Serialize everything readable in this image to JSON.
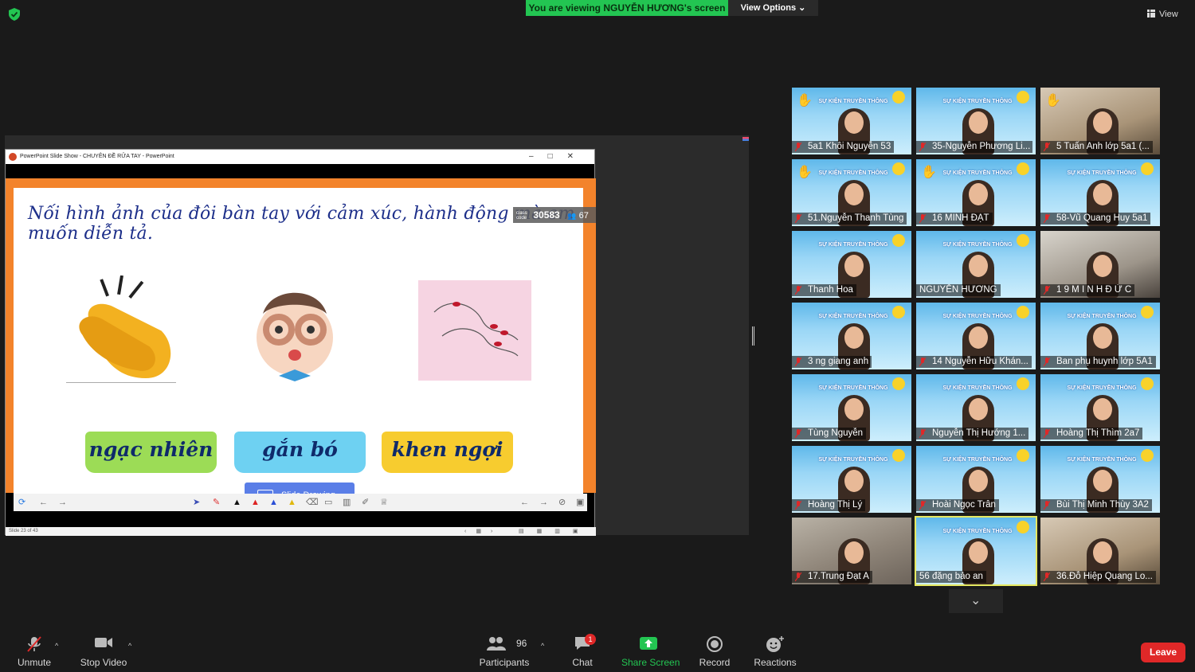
{
  "top": {
    "viewing_banner": "You are viewing NGUYỄN HƯƠNG's screen",
    "view_options": "View Options",
    "view_label": "View"
  },
  "ppt": {
    "window_title": "PowerPoint Slide Show  -  CHUYÊN ĐỀ RỬA TAY  -  PowerPoint",
    "slide_title": "Nối hình ảnh của đôi bàn tay với cảm xúc, hành động mà em muốn diễn tả.",
    "class_code_label": "class code",
    "class_code": "30583",
    "participant_count": "67",
    "words": [
      "ngạc nhiên",
      "gắn bó",
      "khen ngợi"
    ],
    "slide_drawing_button": "Slide Drawing",
    "status": "Slide 23 of 43"
  },
  "gallery": {
    "tiles": [
      {
        "name": "5a1 Khôi Nguyễn 53"
      },
      {
        "name": "35-Nguyễn Phương Li..."
      },
      {
        "name": "5 Tuấn Anh lớp 5a1 (..."
      },
      {
        "name": "51.Nguyễn Thanh Tùng"
      },
      {
        "name": "16 MINH ĐẠT"
      },
      {
        "name": "58-Vũ Quang Huy 5a1"
      },
      {
        "name": "Thanh Hoa"
      },
      {
        "name": "NGUYỄN HƯƠNG"
      },
      {
        "name": "1 9 M I N H Đ Ứ C"
      },
      {
        "name": "3 ng giang anh"
      },
      {
        "name": "14 Nguyễn Hữu Khán..."
      },
      {
        "name": "Ban phụ huynh lớp 5A1"
      },
      {
        "name": "Tùng Nguyễn"
      },
      {
        "name": "Nguyễn Thị Hướng 1..."
      },
      {
        "name": "Hoàng Thị Thìm 2a7"
      },
      {
        "name": "Hoàng Thị Lý"
      },
      {
        "name": "Hoài Ngọc Trân"
      },
      {
        "name": "Bùi Thị Minh Thùy 3A2"
      },
      {
        "name": "17.Trung Đạt A"
      },
      {
        "name": "56 đặng  bảo an"
      },
      {
        "name": "36.Đỗ Hiệp Quang Lo..."
      }
    ],
    "tile_banner": "SỰ KIỆN TRUYỀN THÔNG"
  },
  "controls": {
    "unmute": "Unmute",
    "stop_video": "Stop Video",
    "participants_count": "96",
    "participants": "Participants",
    "chat": "Chat",
    "chat_badge": "1",
    "share_screen": "Share Screen",
    "record": "Record",
    "reactions": "Reactions",
    "leave": "Leave"
  },
  "colors": {
    "banner_green": "#23c552",
    "leave_red": "#e02828",
    "active_speaker": "#e6e861",
    "slide_orange": "#f3832b"
  }
}
